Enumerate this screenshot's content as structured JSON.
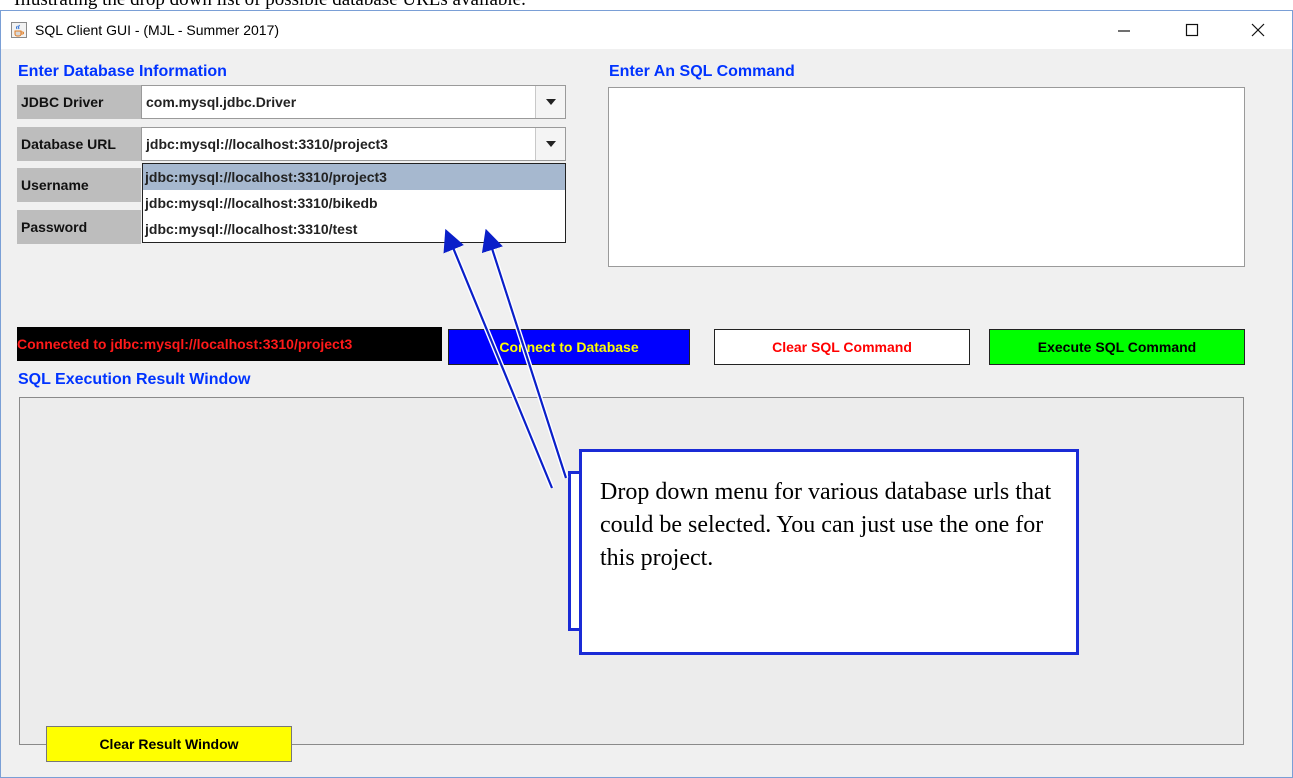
{
  "document": {
    "text_strip": "Illustrating the drop down list of possible database URLs available."
  },
  "window": {
    "title": "SQL Client GUI - (MJL - Summer 2017)",
    "controls": {
      "minimize": "—",
      "maximize": "☐",
      "close": "✕"
    }
  },
  "db_info": {
    "section_title": "Enter Database Information",
    "jdbc_driver": {
      "label": "JDBC Driver",
      "value": "com.mysql.jdbc.Driver"
    },
    "database_url": {
      "label": "Database URL",
      "value": "jdbc:mysql://localhost:3310/project3",
      "options": [
        "jdbc:mysql://localhost:3310/project3",
        "jdbc:mysql://localhost:3310/bikedb",
        "jdbc:mysql://localhost:3310/test"
      ],
      "selected_index": 0
    },
    "username_label": "Username",
    "password_label": "Password"
  },
  "sql": {
    "section_title": "Enter An SQL Command",
    "command": ""
  },
  "status": {
    "text": "Connected to jdbc:mysql://localhost:3310/project3",
    "color": "#ff1a1a"
  },
  "buttons": {
    "connect": "Connect to Database",
    "clear_sql": "Clear SQL Command",
    "execute": "Execute SQL Command",
    "clear_result": "Clear Result Window"
  },
  "result": {
    "section_title": "SQL Execution Result Window"
  },
  "annotation": {
    "text": "Drop down menu for various database urls that could be selected. You can just use the one for this project."
  },
  "colors": {
    "section_title": "#0033ff",
    "connect_bg": "#0000ff",
    "connect_fg": "#ffff00",
    "execute_bg": "#00ff00",
    "clear_result_bg": "#ffff00",
    "callout_border": "#1a2bd6"
  }
}
